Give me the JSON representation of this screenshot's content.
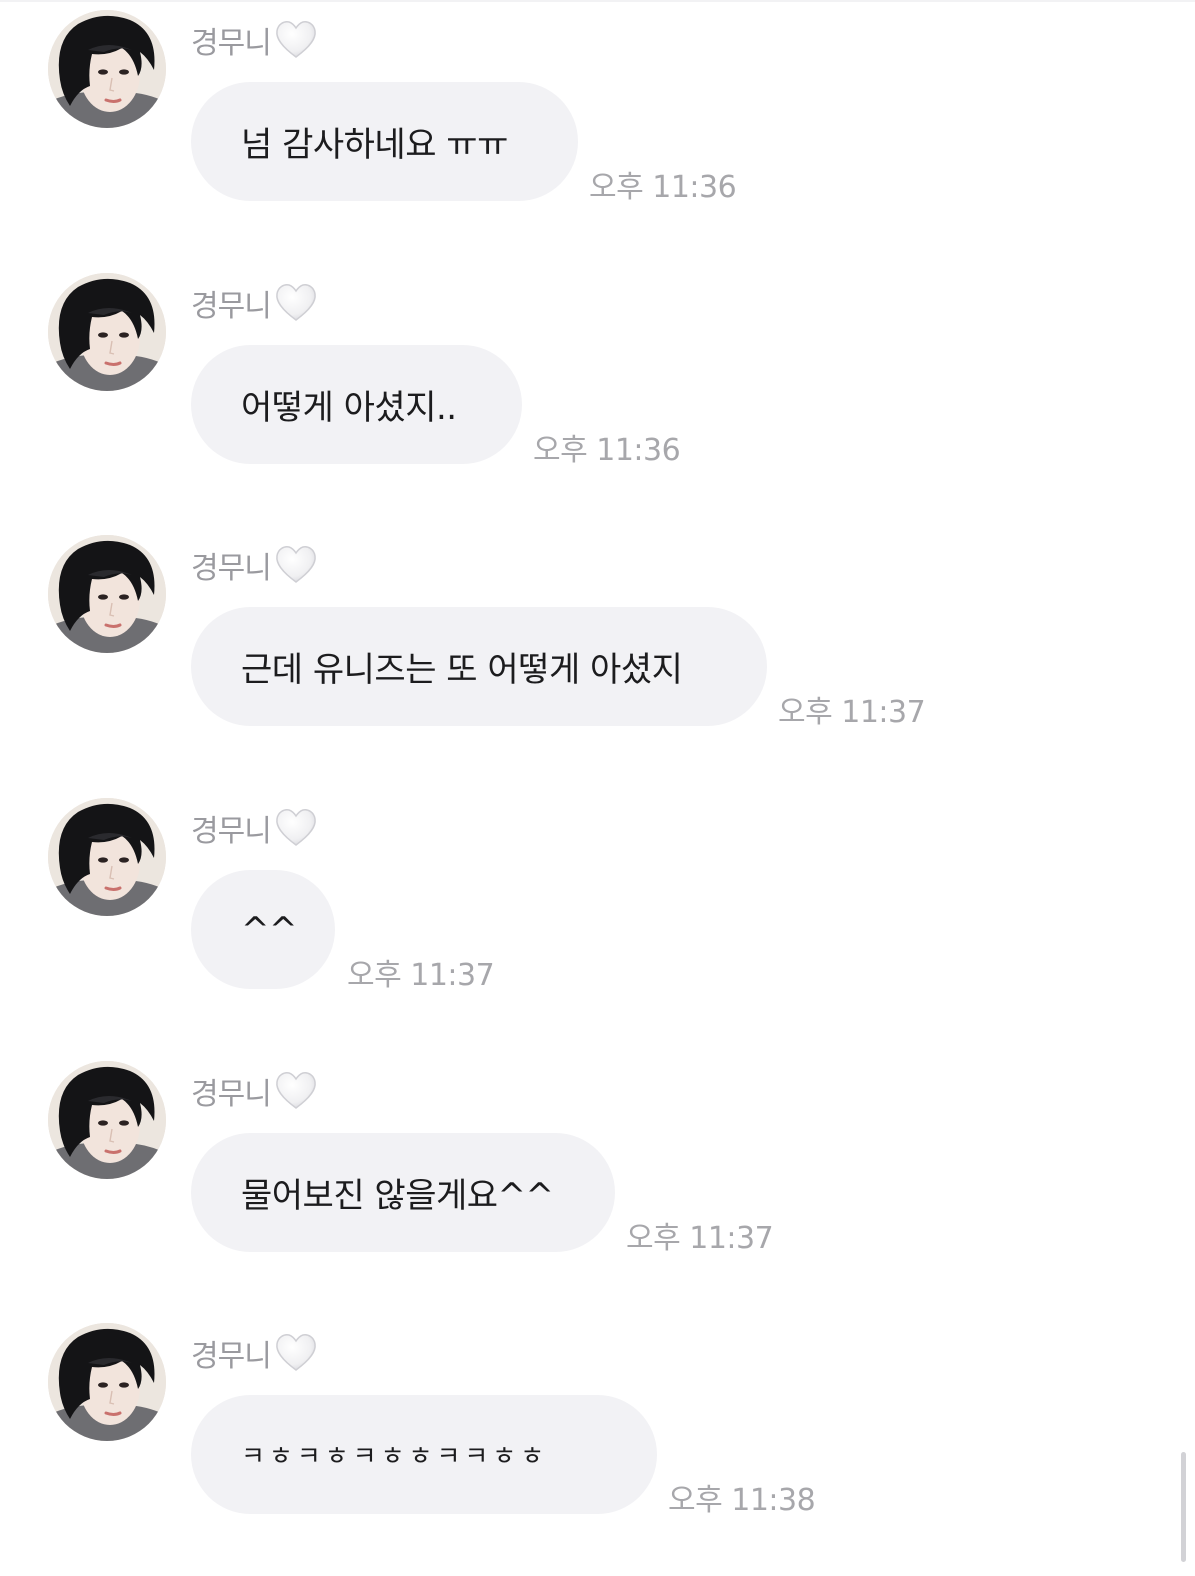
{
  "chat": {
    "sender_name": "경무니",
    "sender_heart_icon": "white-heart-icon",
    "colors": {
      "bubble_bg": "#f2f2f5",
      "bubble_text": "#1c1c1e",
      "name_text": "#9a9a9f",
      "time_text": "#a7a7ab",
      "background": "#ffffff"
    },
    "messages": [
      {
        "sender": "경무니",
        "text": "넘 감사하네요 ㅠㅠ",
        "time": "오후 11:36"
      },
      {
        "sender": "경무니",
        "text": "어떻게 아셨지..",
        "time": "오후 11:36"
      },
      {
        "sender": "경무니",
        "text": "근데 유니즈는 또 어떻게 아셨지",
        "time": "오후 11:37"
      },
      {
        "sender": "경무니",
        "text": "^^",
        "time": "오후 11:37"
      },
      {
        "sender": "경무니",
        "text": "물어보진 않을게요^^",
        "time": "오후 11:37"
      },
      {
        "sender": "경무니",
        "text": "ㅋㅎㅋㅎㅋㅎㅎㅋㅋㅎㅎ",
        "time": "오후 11:38"
      }
    ]
  }
}
